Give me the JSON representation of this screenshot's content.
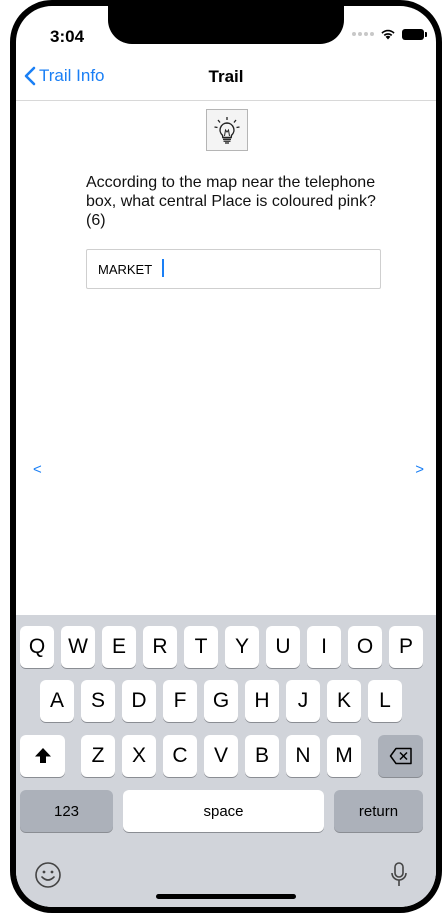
{
  "status": {
    "time": "3:04"
  },
  "nav": {
    "back_label": "Trail Info",
    "title": "Trail"
  },
  "content": {
    "hint_icon": "lightbulb-icon",
    "question": "According to the map near the telephone box, what central Place is coloured pink? (6)",
    "answer_value": "MARKET",
    "prev_label": "<",
    "next_label": ">"
  },
  "keyboard": {
    "row1": [
      "Q",
      "W",
      "E",
      "R",
      "T",
      "Y",
      "U",
      "I",
      "O",
      "P"
    ],
    "row2": [
      "A",
      "S",
      "D",
      "F",
      "G",
      "H",
      "J",
      "K",
      "L"
    ],
    "row3": [
      "Z",
      "X",
      "C",
      "V",
      "B",
      "N",
      "M"
    ],
    "numbers_label": "123",
    "space_label": "space",
    "return_label": "return"
  },
  "colors": {
    "accent": "#1a7ff5",
    "keyboard_bg": "#d1d4da"
  }
}
